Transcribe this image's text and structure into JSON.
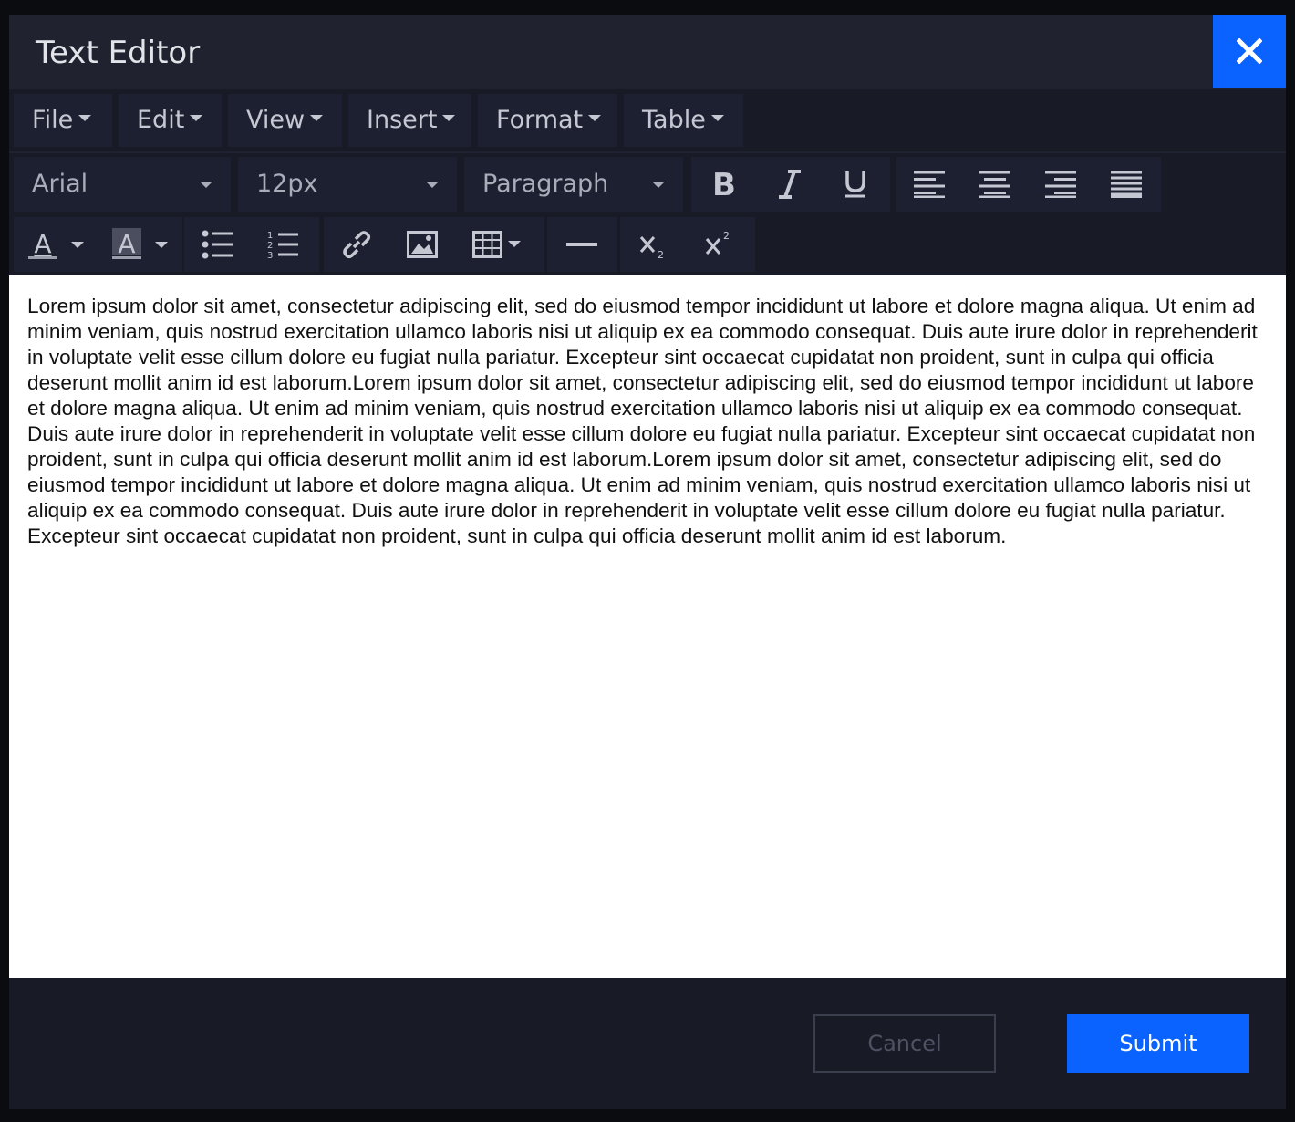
{
  "window": {
    "title": "Text Editor"
  },
  "menu": {
    "items": [
      {
        "label": "File"
      },
      {
        "label": "Edit"
      },
      {
        "label": "View"
      },
      {
        "label": "Insert"
      },
      {
        "label": "Format"
      },
      {
        "label": "Table"
      }
    ]
  },
  "toolbar": {
    "font_family": "Arial",
    "font_size": "12px",
    "block_format": "Paragraph",
    "icons": [
      "bold-icon",
      "italic-icon",
      "underline-icon",
      "align-left-icon",
      "align-center-icon",
      "align-right-icon",
      "align-justify-icon",
      "text-color-icon",
      "highlight-color-icon",
      "bullet-list-icon",
      "numbered-list-icon",
      "link-icon",
      "image-icon",
      "table-icon",
      "horizontal-rule-icon",
      "subscript-icon",
      "superscript-icon"
    ]
  },
  "editor": {
    "content": "Lorem ipsum dolor sit amet, consectetur adipiscing elit, sed do eiusmod tempor incididunt ut labore et dolore magna aliqua. Ut enim ad minim veniam, quis nostrud exercitation ullamco laboris nisi ut aliquip ex ea commodo consequat. Duis aute irure dolor in reprehenderit in voluptate velit esse cillum dolore eu fugiat nulla pariatur. Excepteur sint occaecat cupidatat non proident, sunt in culpa qui officia deserunt mollit anim id est laborum.Lorem ipsum dolor sit amet, consectetur adipiscing elit, sed do eiusmod tempor incididunt ut labore et dolore magna aliqua. Ut enim ad minim veniam, quis nostrud exercitation ullamco laboris nisi ut aliquip ex ea commodo consequat. Duis aute irure dolor in reprehenderit in voluptate velit esse cillum dolore eu fugiat nulla pariatur. Excepteur sint occaecat cupidatat non proident, sunt in culpa qui officia deserunt mollit anim id est laborum.Lorem ipsum dolor sit amet, consectetur adipiscing elit, sed do eiusmod tempor incididunt ut labore et dolore magna aliqua. Ut enim ad minim veniam, quis nostrud exercitation ullamco laboris nisi ut aliquip ex ea commodo consequat. Duis aute irure dolor in reprehenderit in voluptate velit esse cillum dolore eu fugiat nulla pariatur. Excepteur sint occaecat cupidatat non proident, sunt in culpa qui officia deserunt mollit anim id est laborum."
  },
  "footer": {
    "cancel_label": "Cancel",
    "submit_label": "Submit"
  },
  "colors": {
    "accent": "#0a62ff",
    "background": "#181b26",
    "header": "#20232f"
  }
}
